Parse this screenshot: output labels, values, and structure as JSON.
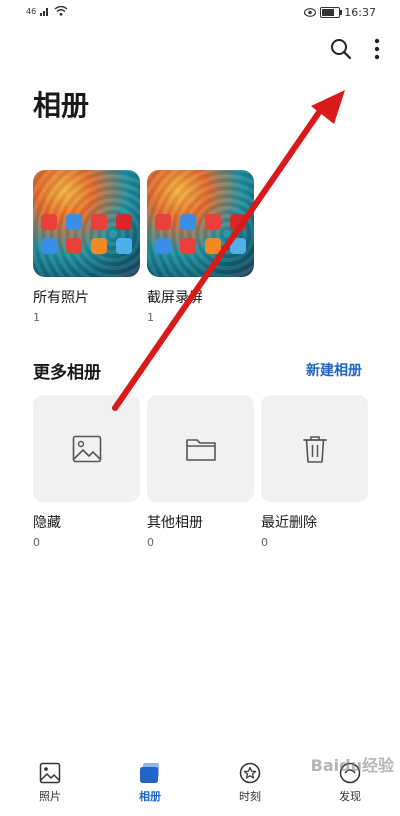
{
  "status": {
    "left": "46",
    "time": "16:37"
  },
  "header": {
    "title": "相册"
  },
  "albums": [
    {
      "name": "所有照片",
      "count": "1"
    },
    {
      "name": "截屏录屏",
      "count": "1"
    }
  ],
  "more": {
    "title": "更多相册",
    "new_album": "新建相册",
    "items": [
      {
        "name": "隐藏",
        "count": "0",
        "icon": "image-icon"
      },
      {
        "name": "其他相册",
        "count": "0",
        "icon": "folder-icon"
      },
      {
        "name": "最近删除",
        "count": "0",
        "icon": "trash-icon"
      }
    ]
  },
  "nav": [
    {
      "label": "照片",
      "icon": "photo-icon"
    },
    {
      "label": "相册",
      "icon": "albums-icon",
      "active": true
    },
    {
      "label": "时刻",
      "icon": "star-icon"
    },
    {
      "label": "发现",
      "icon": "discover-icon"
    }
  ],
  "watermark": "Baidu经验",
  "colors": {
    "accent": "#1f66c8",
    "arrow": "#d91a1a"
  }
}
